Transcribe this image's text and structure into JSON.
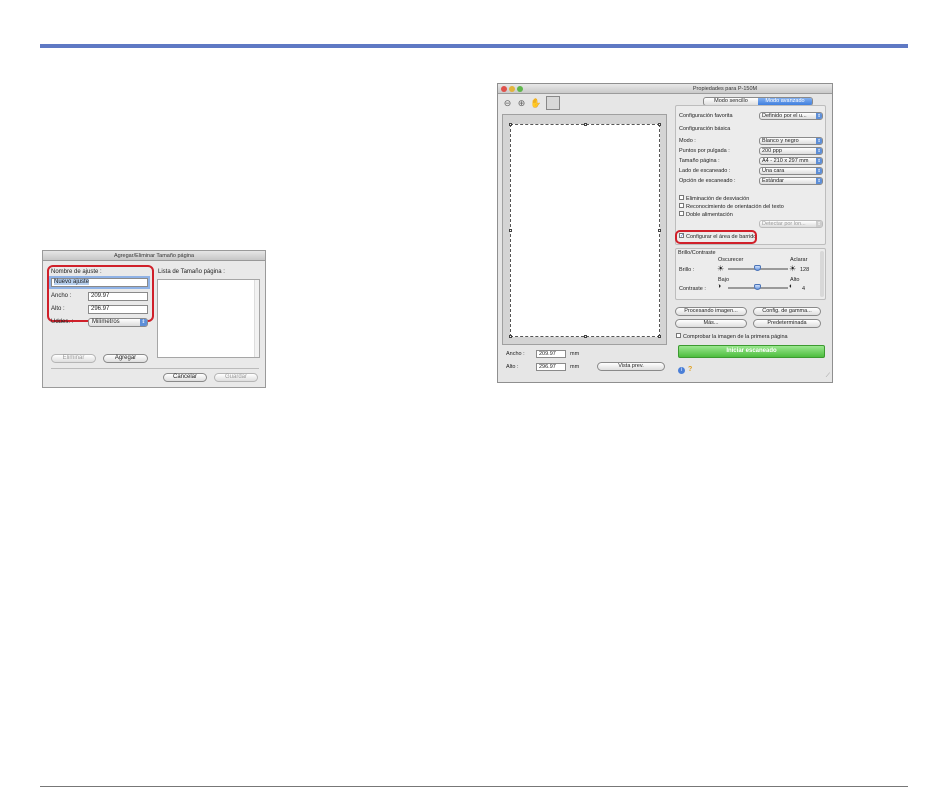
{
  "left_dialog": {
    "title": "Agregar/Eliminar Tamaño página",
    "name_label": "Nombre de ajuste :",
    "name_value": "Nuevo ajuste",
    "width_label": "Ancho :",
    "width_value": "209.97",
    "height_label": "Alto :",
    "height_value": "296.97",
    "units_label": "Uddes. :",
    "units_value": "Milímetros",
    "list_label": "Lista de Tamaño página :",
    "delete_label": "Eliminar",
    "add_label": "Agregar",
    "cancel_label": "Cancelar",
    "save_label": "Guardar"
  },
  "right_window": {
    "title": "Propiedades para P-150M",
    "tabs": [
      "Modo sencillo",
      "Modo avanzado"
    ],
    "favorite_label": "Configuración favorita",
    "favorite_value": "Definido por el u...",
    "basic_title": "Configuración básica",
    "mode_label": "Modo :",
    "mode_value": "Blanco y negro",
    "dpi_label": "Puntos por pulgada :",
    "dpi_value": "200 ppp",
    "size_label": "Tamaño página :",
    "size_value": "A4 - 210 x 297 mm",
    "side_label": "Lado de escaneado :",
    "side_value": "Una cara",
    "option_label": "Opción de escaneado :",
    "option_value": "Estándar",
    "check_deskew": "Eliminación de desviación",
    "check_orient": "Reconocimiento de orientación del texto",
    "check_double": "Doble alimentación",
    "detect_value": "Detectar por lon...",
    "check_scan_area": "Configurar el área de barrido",
    "bc_title": "Brillo/Contraste",
    "darken_label": "Oscurecer",
    "lighten_label": "Aclarar",
    "brightness_label": "Brillo :",
    "brightness_value": "128",
    "low_label": "Bajo",
    "high_label": "Alto",
    "contrast_label": "Contraste :",
    "contrast_value": "4",
    "image_proc_label": "Procesando imagen...",
    "gamma_label": "Config. de gamma...",
    "more_label": "Más...",
    "default_label": "Predeterminada",
    "check_first_page": "Comprobar la imagen de la primera página",
    "start_scan_label": "Iniciar escaneado",
    "width_label": "Ancho :",
    "width_value": "209.97",
    "height_label": "Alto :",
    "height_value": "296.97",
    "unit_mm": "mm",
    "preview_label": "Vista prev.",
    "help_icon_text": "?",
    "info_icon_text": "i"
  },
  "colors": {
    "accent_rule": "#5f79c4",
    "highlight": "#d0202a",
    "scan_button": "#4dbd3e",
    "selected_tab": "#3f7fde"
  }
}
